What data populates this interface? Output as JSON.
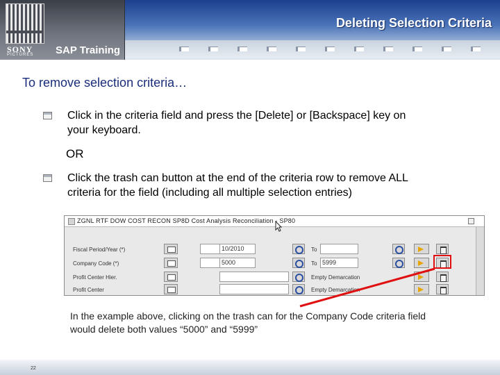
{
  "header": {
    "logo_brand": "SONY",
    "logo_sub": "PICTURES",
    "program": "SAP Training",
    "slide_title": "Deleting Selection Criteria"
  },
  "content": {
    "intro": "To remove selection criteria…",
    "step1_line1": "Click in the criteria field and press the [Delete] or [Backspace] key on",
    "step1_line2": "your keyboard.",
    "or_label": "OR",
    "step2_line1": "Click the trash can button at the end of the criteria row to remove ALL",
    "step2_line2": "criteria for the field (including all multiple selection entries)"
  },
  "sap_screen": {
    "title": "ZGNL RTF DOW COST RECON SP8D Cost Analysis Reconciliation - SP80",
    "rows": [
      {
        "label": "Fiscal Period/Year (*)",
        "from": "10/2010",
        "to_label": "To",
        "to": ""
      },
      {
        "label": "Company Code (*)",
        "from": "5000",
        "to_label": "To",
        "to": "5999"
      },
      {
        "label": "Profit Center Hier.",
        "from": "",
        "to_label": "Empty Demarcation",
        "to": ""
      },
      {
        "label": "Profit Center",
        "from": "",
        "to_label": "Empty Demarcation",
        "to": ""
      }
    ]
  },
  "caption": {
    "line1": "In the example above, clicking on the trash can for the Company Code criteria field",
    "line2": "would delete both values “5000” and “5999”"
  },
  "footer": {
    "page_number": "22"
  },
  "colors": {
    "header_blue": "#1c3f8e",
    "intro_text": "#1a2d7a",
    "highlight_red": "#e01010"
  }
}
